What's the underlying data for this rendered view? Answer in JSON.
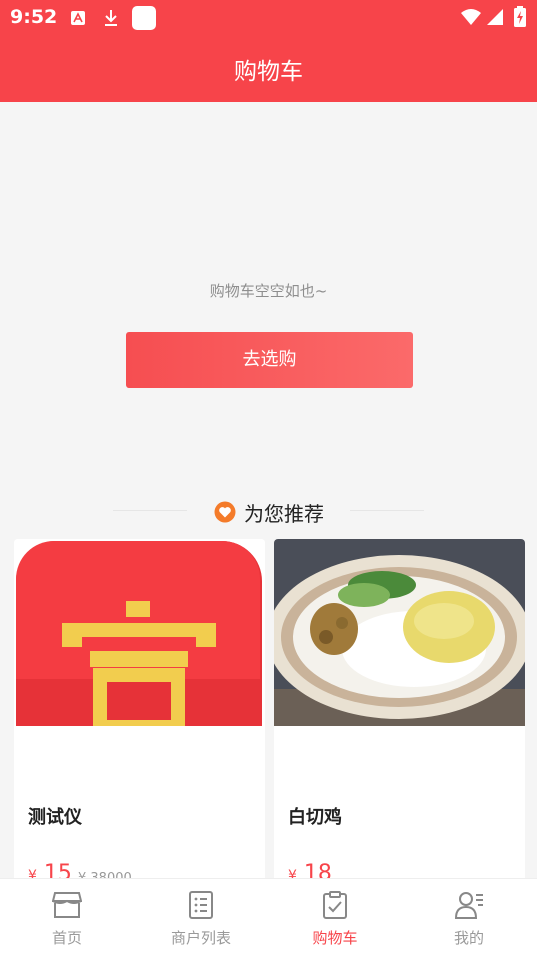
{
  "status_bar": {
    "time": "9:52"
  },
  "header": {
    "title": "购物车"
  },
  "empty_cart": {
    "message": "购物车空空如也~",
    "button_label": "去选购"
  },
  "recommend": {
    "title": "为您推荐",
    "products": [
      {
        "name": "测试仪",
        "price_symbol": "¥",
        "price": "15",
        "original_price": "¥ 38000",
        "image_icon": "fu-logo-icon"
      },
      {
        "name": "白切鸡",
        "price_symbol": "¥",
        "price": "18",
        "original_price": "",
        "image_icon": "chicken-rice-photo"
      }
    ]
  },
  "tab_bar": {
    "tabs": [
      {
        "label": "首页",
        "icon": "store-icon"
      },
      {
        "label": "商户列表",
        "icon": "list-icon"
      },
      {
        "label": "购物车",
        "icon": "clipboard-check-icon",
        "active": true
      },
      {
        "label": "我的",
        "icon": "user-icon"
      }
    ]
  },
  "colors": {
    "brand": "#f7444a",
    "gold": "#f2cd4e"
  }
}
